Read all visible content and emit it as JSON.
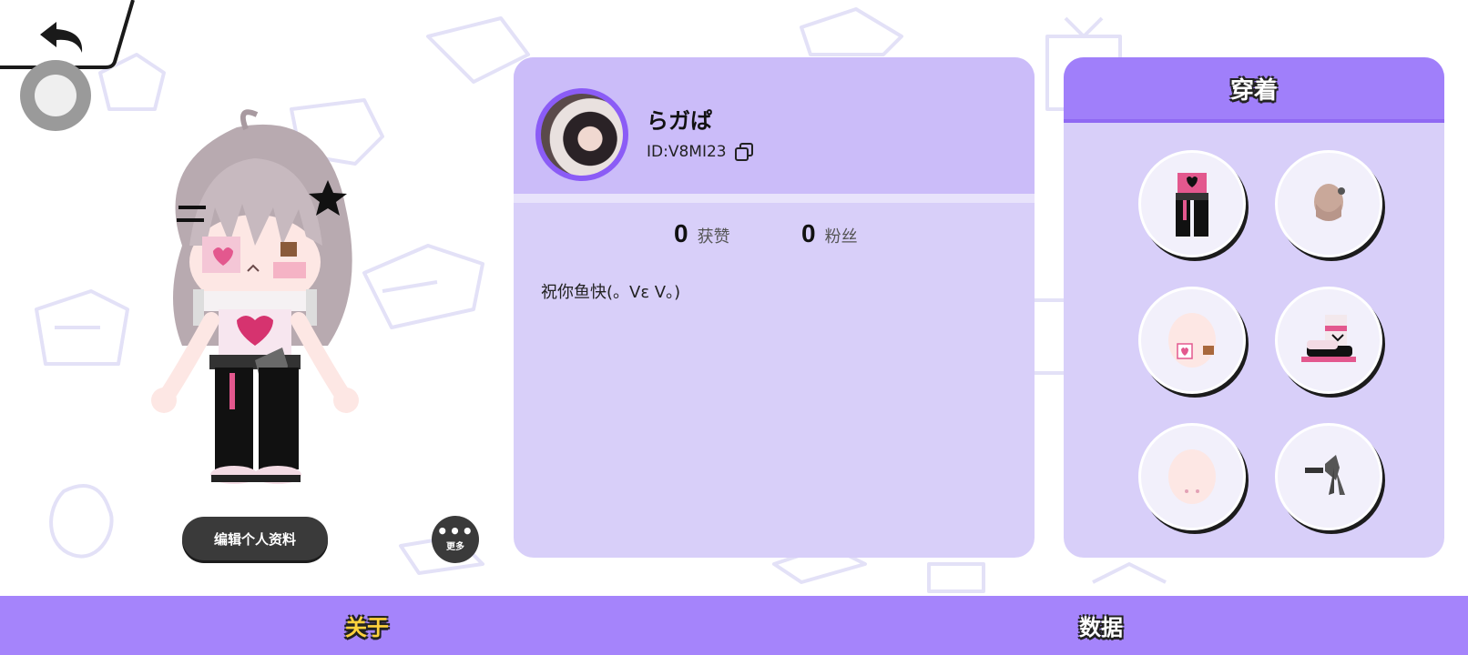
{
  "profile": {
    "username": "らガぱ",
    "user_id": "ID:V8MI23",
    "stats": {
      "likes_count": "0",
      "likes_label": "获赞",
      "fans_count": "0",
      "fans_label": "粉丝"
    },
    "bio": "祝你鱼快(。ᐯɛ ᐯ。)"
  },
  "actions": {
    "edit_profile_label": "编辑个人资料",
    "more_label": "更多"
  },
  "wearing": {
    "title": "穿着",
    "slots": [
      "outfit-icon",
      "hair-icon",
      "face-icon",
      "shoes-icon",
      "head-base-icon",
      "ribbon-accessory-icon"
    ]
  },
  "tabs": [
    {
      "label": "关于",
      "active": true
    },
    {
      "label": "数据",
      "active": false
    }
  ],
  "colors": {
    "accent": "#a584fb",
    "card": "#d8cff9",
    "active_tab_text": "#ffd23d"
  }
}
